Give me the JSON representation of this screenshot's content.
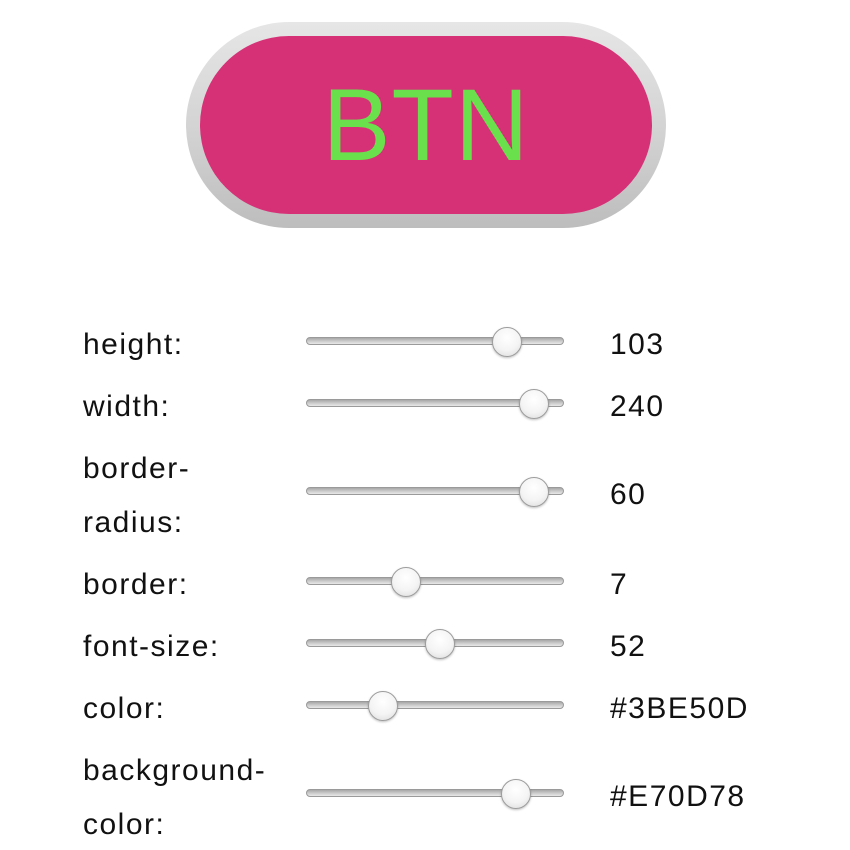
{
  "preview": {
    "button_text": "BTN",
    "text_color": "#6ae04c",
    "background_color": "#d63177",
    "border_color": "#cccccc"
  },
  "controls": [
    {
      "label": "height:",
      "value": "103",
      "slider_fraction": 0.82
    },
    {
      "label": "width:",
      "value": "240",
      "slider_fraction": 0.94
    },
    {
      "label_line1": "border-",
      "label_line2": "radius:",
      "value": "60",
      "slider_fraction": 0.94
    },
    {
      "label": "border:",
      "value": "7",
      "slider_fraction": 0.37
    },
    {
      "label": "font-size:",
      "value": "52",
      "slider_fraction": 0.52
    },
    {
      "label": "color:",
      "value": "#3BE50D",
      "slider_fraction": 0.27
    },
    {
      "label_line1": "background-",
      "label_line2": "color:",
      "value": "#E70D78",
      "slider_fraction": 0.86
    }
  ]
}
